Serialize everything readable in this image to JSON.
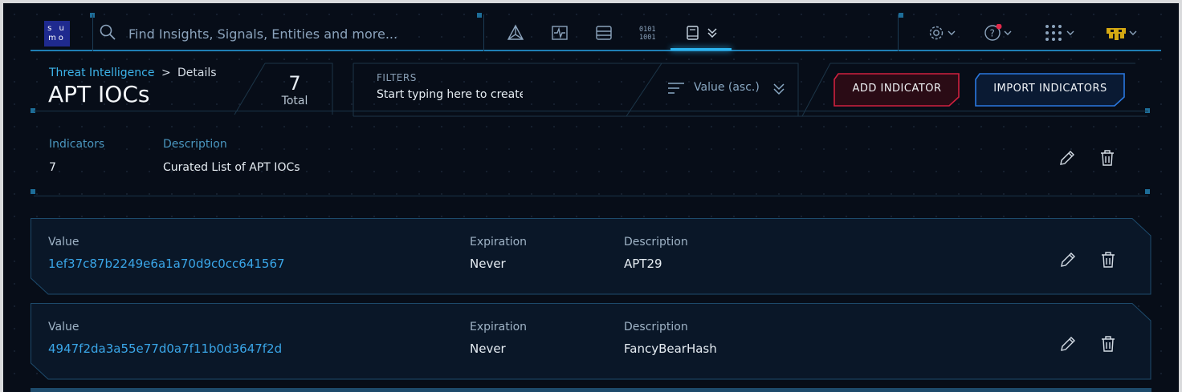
{
  "topbar": {
    "logo_text_top": "s u",
    "logo_text_bottom": "mo",
    "search_placeholder": "Find Insights, Signals, Entities and more...",
    "nav_icons": [
      "insights-icon",
      "signals-icon",
      "records-icon",
      "entities-icon",
      "content-icon"
    ],
    "right_icons": [
      "settings-icon",
      "help-icon",
      "apps-grid-icon",
      "avatar-icon"
    ],
    "accent": "#2db5f0",
    "notification_dot": "#e2294a"
  },
  "header": {
    "breadcrumb_link": "Threat Intelligence",
    "breadcrumb_sep": ">",
    "breadcrumb_current": "Details",
    "title": "APT IOCs",
    "total_count": "7",
    "total_label": "Total",
    "filters_label": "FILTERS",
    "filters_placeholder": "Start typing here to create",
    "sort_label": "Value (asc.)",
    "add_button": "ADD INDICATOR",
    "import_button": "IMPORT INDICATORS",
    "add_color": "#d0203f",
    "import_color": "#2a78e0"
  },
  "summary": {
    "indicators_label": "Indicators",
    "indicators_value": "7",
    "description_label": "Description",
    "description_value": "Curated List of APT IOCs"
  },
  "rows": [
    {
      "value_label": "Value",
      "value": "1ef37c87b2249e6a1a70d9c0cc641567",
      "expiration_label": "Expiration",
      "expiration": "Never",
      "description_label": "Description",
      "description": "APT29"
    },
    {
      "value_label": "Value",
      "value": "4947f2da3a55e77d0a7f11b0d3647f2d",
      "expiration_label": "Expiration",
      "expiration": "Never",
      "description_label": "Description",
      "description": "FancyBearHash"
    }
  ]
}
